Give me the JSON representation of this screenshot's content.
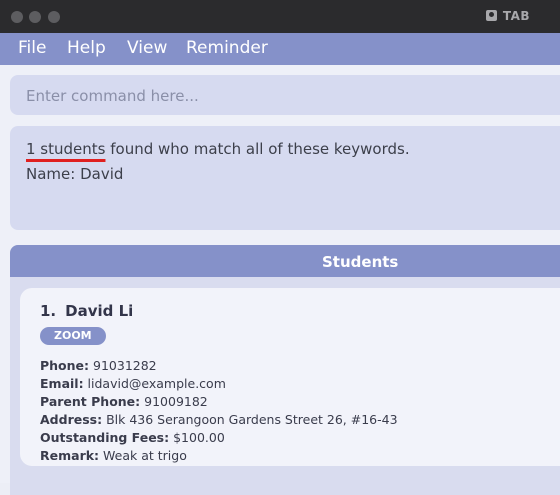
{
  "window": {
    "title": "TAB"
  },
  "menu": [
    "File",
    "Help",
    "View",
    "Reminder"
  ],
  "command": {
    "placeholder": "Enter command here...",
    "value": ""
  },
  "result": {
    "highlight": "1 students",
    "rest": " found who match all of these keywords.",
    "line2": "Name: David"
  },
  "panel": {
    "title": "Students"
  },
  "students": [
    {
      "index": "1.",
      "name": "David Li",
      "tag": "ZOOM",
      "phone_label": "Phone:",
      "phone": " 91031282",
      "email_label": "Email:",
      "email": " lidavid@example.com",
      "parent_label": "Parent Phone:",
      "parent_phone": " 91009182",
      "address_label": "Address:",
      "address": " Blk 436 Serangoon Gardens Street 26, #16-43",
      "fees_label": "Outstanding Fees:",
      "fees": " $100.00",
      "remark_label": "Remark:",
      "remark": " Weak at trigo"
    }
  ]
}
